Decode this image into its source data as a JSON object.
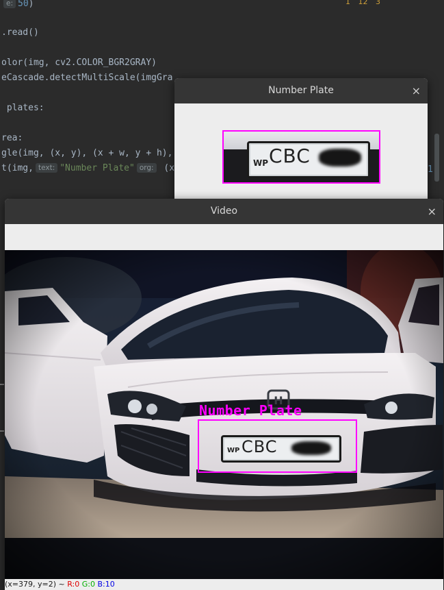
{
  "editor": {
    "lines": [
      {
        "pre": "",
        "hint": "e:",
        "num": "50",
        "post": ")"
      },
      {
        "text": ".read()"
      },
      {
        "text": "olor(img, cv2.COLOR_BGR2GRAY)"
      },
      {
        "text": "eCascade.detectMultiScale(imgGra"
      },
      {
        "text": " plates:"
      },
      {
        "text": "rea:"
      },
      {
        "text": "gle(img, (x, y), (x + w, y + h),"
      },
      {
        "pre": "t(img,",
        "hint": "text:",
        "str": "\"Number Plate\"",
        "hint2": "org:",
        "post": " (x"
      }
    ],
    "right_num": "1,",
    "inspections": [
      "1",
      "12",
      "3"
    ]
  },
  "plate_window": {
    "title": "Number Plate",
    "close": "×"
  },
  "plate": {
    "prefix": "WP",
    "letters": "CBC"
  },
  "video_window": {
    "title": "Video",
    "close": "×",
    "detection_label": "Number Plate",
    "status": {
      "coords": "(x=379, y=2) ~",
      "r": "R:0",
      "g": "G:0",
      "b": "B:10"
    }
  },
  "colors": {
    "detection": "#ff00ff",
    "editor_bg": "#2b2b2b",
    "titlebar": "#353535"
  }
}
